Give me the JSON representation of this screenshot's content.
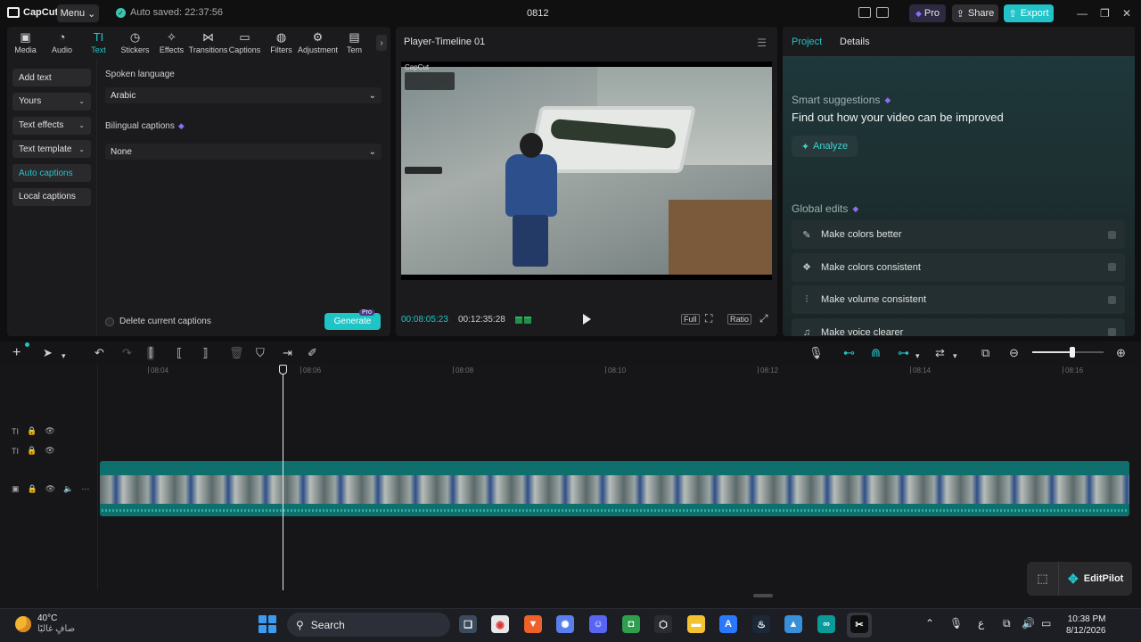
{
  "app": {
    "logo_text": "CapCut",
    "menu_label": "Menu",
    "autosave": "Auto saved: 22:37:56",
    "project_title": "0812",
    "pro_label": "Pro",
    "share_label": "Share",
    "export_label": "Export",
    "colors": {
      "accent": "#22c5c9",
      "export": "#21c3c8",
      "pro": "#8c6cf0"
    }
  },
  "tool_tabs": [
    {
      "label": "Media",
      "icon": "media-icon",
      "glyph": "▣"
    },
    {
      "label": "Audio",
      "icon": "audio-icon",
      "glyph": "◔"
    },
    {
      "label": "Text",
      "icon": "text-icon",
      "glyph": "TI",
      "active": true
    },
    {
      "label": "Stickers",
      "icon": "sticker-icon",
      "glyph": "◷"
    },
    {
      "label": "Effects",
      "icon": "effects-icon",
      "glyph": "✧"
    },
    {
      "label": "Transitions",
      "icon": "transitions-icon",
      "glyph": "⋈"
    },
    {
      "label": "Captions",
      "icon": "captions-icon",
      "glyph": "▭"
    },
    {
      "label": "Filters",
      "icon": "filters-icon",
      "glyph": "◍"
    },
    {
      "label": "Adjustment",
      "icon": "adjustment-icon",
      "glyph": "⚙"
    },
    {
      "label": "Tem",
      "icon": "templates-icon",
      "glyph": "▤"
    }
  ],
  "side_items": [
    {
      "label": "Add text",
      "chevron": false
    },
    {
      "label": "Yours",
      "chevron": true
    },
    {
      "label": "Text effects",
      "chevron": true
    },
    {
      "label": "Text template",
      "chevron": true
    },
    {
      "label": "Auto captions",
      "chevron": false,
      "active": true
    },
    {
      "label": "Local captions",
      "chevron": false
    }
  ],
  "captions": {
    "spoken_language_label": "Spoken language",
    "spoken_language_value": "Arabic",
    "bilingual_label": "Bilingual captions",
    "bilingual_value": "None",
    "delete_label": "Delete current captions",
    "generate_label": "Generate",
    "pro_tag": "Pro"
  },
  "player": {
    "title": "Player-Timeline 01",
    "watermark": "CapCut",
    "time_current": "00:08:05:23",
    "time_total": "00:12:35:28",
    "full_label": "Full",
    "ratio_label": "Ratio"
  },
  "right_panel": {
    "tab_project": "Project",
    "tab_details": "Details",
    "smart_label": "Smart suggestions",
    "headline": "Find out how your video can be improved",
    "analyze_label": "Analyze",
    "global_label": "Global edits",
    "edits": [
      {
        "label": "Make colors better",
        "icon": "color-wand-icon",
        "glyph": "✎"
      },
      {
        "label": "Make colors consistent",
        "icon": "color-match-icon",
        "glyph": "❖"
      },
      {
        "label": "Make volume consistent",
        "icon": "volume-adjust-icon",
        "glyph": "⫶"
      },
      {
        "label": "Make voice clearer",
        "icon": "voice-wave-icon",
        "glyph": "♫"
      }
    ]
  },
  "timeline": {
    "ruler": [
      "08:04",
      "08:06",
      "08:08",
      "08:10",
      "08:12",
      "08:14",
      "08:16"
    ]
  },
  "editpilot": {
    "label": "EditPilot"
  },
  "taskbar": {
    "temp": "40°C",
    "condition": "صافٍ غالبًا",
    "search": "Search",
    "lang": "ع",
    "time": "10:38 PM",
    "date": "8/12/2026"
  }
}
